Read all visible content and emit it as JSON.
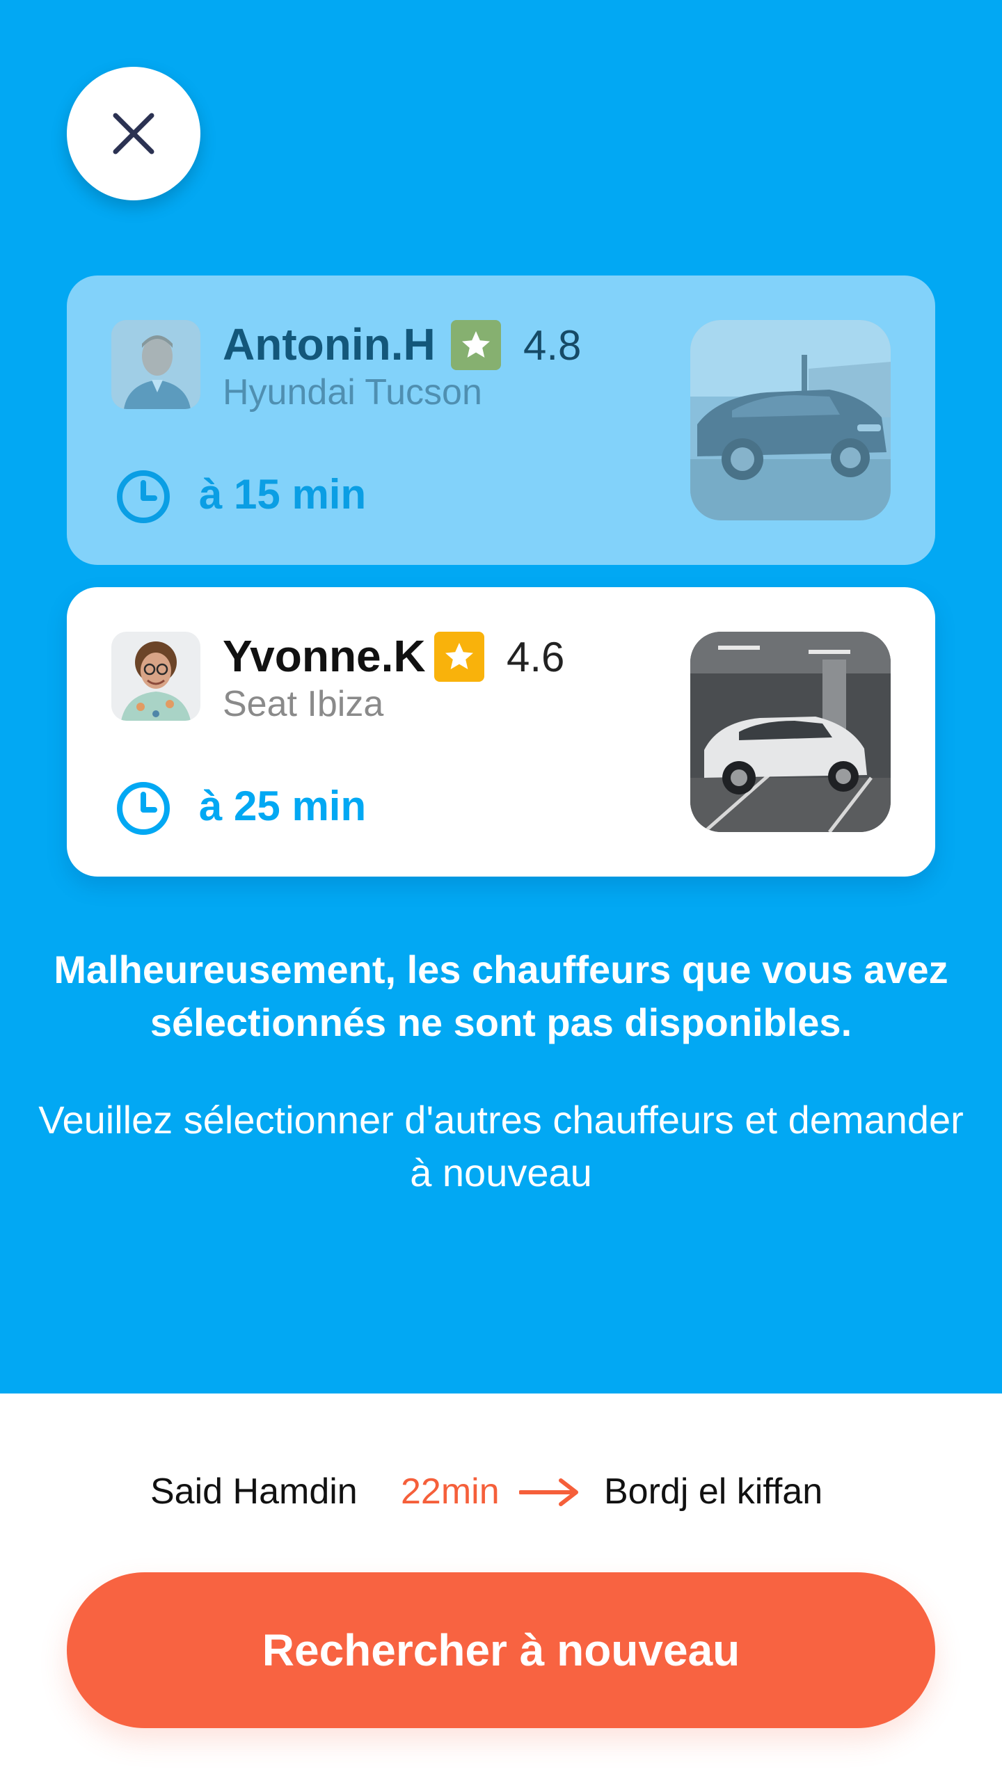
{
  "colors": {
    "primary_blue": "#02a8f3",
    "accent_orange": "#f86341",
    "star_yellow": "#f9b20b"
  },
  "header": {
    "close_icon": "close-icon"
  },
  "drivers": [
    {
      "name": "Antonin.H",
      "rating": "4.8",
      "car": "Hyundai Tucson",
      "eta": "à 15 min",
      "state": "unavailable"
    },
    {
      "name": "Yvonne.K",
      "rating": "4.6",
      "car": "Seat Ibiza",
      "eta": "à 25 min",
      "state": "unavailable"
    }
  ],
  "message": {
    "main": "Malheureusement, les chauffeurs que vous avez sélectionnés ne sont pas disponibles.",
    "sub": "Veuillez sélectionner d'autres chauffeurs et demander à nouveau"
  },
  "route": {
    "from": "Said Hamdin",
    "duration": "22min",
    "to": "Bordj el kiffan"
  },
  "actions": {
    "search_again": "Rechercher à nouveau"
  }
}
